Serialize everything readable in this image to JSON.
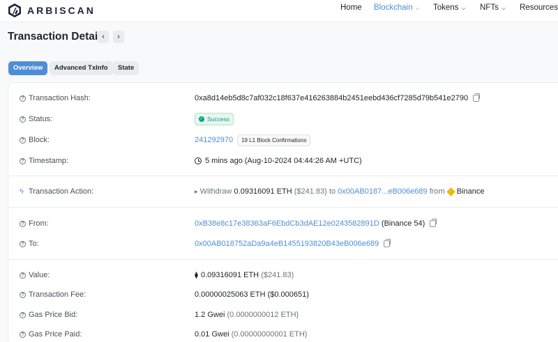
{
  "brand": {
    "name": "ARBISCAN"
  },
  "nav": {
    "home": "Home",
    "blockchain": "Blockchain",
    "tokens": "Tokens",
    "nfts": "NFTs",
    "resources": "Resources"
  },
  "page": {
    "title": "Transaction Details"
  },
  "tabs": {
    "overview": "Overview",
    "advanced": "Advanced TxInfo",
    "state": "State"
  },
  "details": {
    "hash": {
      "label": "Transaction Hash:",
      "value": "0xa8d14eb5d8c7af032c18f637e416263884b2451eebd436cf7285d79b541e2790"
    },
    "status": {
      "label": "Status:",
      "value": "Success"
    },
    "block": {
      "label": "Block:",
      "value": "241292970",
      "confirmations": "19 L1 Block Confirmations"
    },
    "timestamp": {
      "label": "Timestamp:",
      "value": "5 mins ago (Aug-10-2024 04:44:26 AM +UTC)"
    },
    "action": {
      "label": "Transaction Action:",
      "verb": "Withdraw",
      "amount": "0.09316091 ETH",
      "usd": "($241.83)",
      "to_word": "to",
      "to_addr": "0x00AB0187...eB006e689",
      "from_word": "from",
      "from_name": "Binance"
    },
    "from": {
      "label": "From:",
      "address": "0xB38e8c17e38363aF6EbdCb3dAE12e0243582891D",
      "name": "(Binance 54)"
    },
    "to": {
      "label": "To:",
      "address": "0x00AB018752aDa9a4eB1455193820B43eB006e689"
    },
    "value": {
      "label": "Value:",
      "value": "0.09316091 ETH",
      "usd": "($241.83)"
    },
    "fee": {
      "label": "Transaction Fee:",
      "value": "0.00000025063 ETH ($0.000651)"
    },
    "gas_bid": {
      "label": "Gas Price Bid:",
      "value": "1.2 Gwei",
      "sub": "(0.0000000012 ETH)"
    },
    "gas_paid": {
      "label": "Gas Price Paid:",
      "value": "0.01 Gwei",
      "sub": "(0.00000000001 ETH)"
    }
  },
  "colors": {
    "accent": "#4f8ed6",
    "success": "#00a186",
    "binance": "#f0b90b"
  }
}
